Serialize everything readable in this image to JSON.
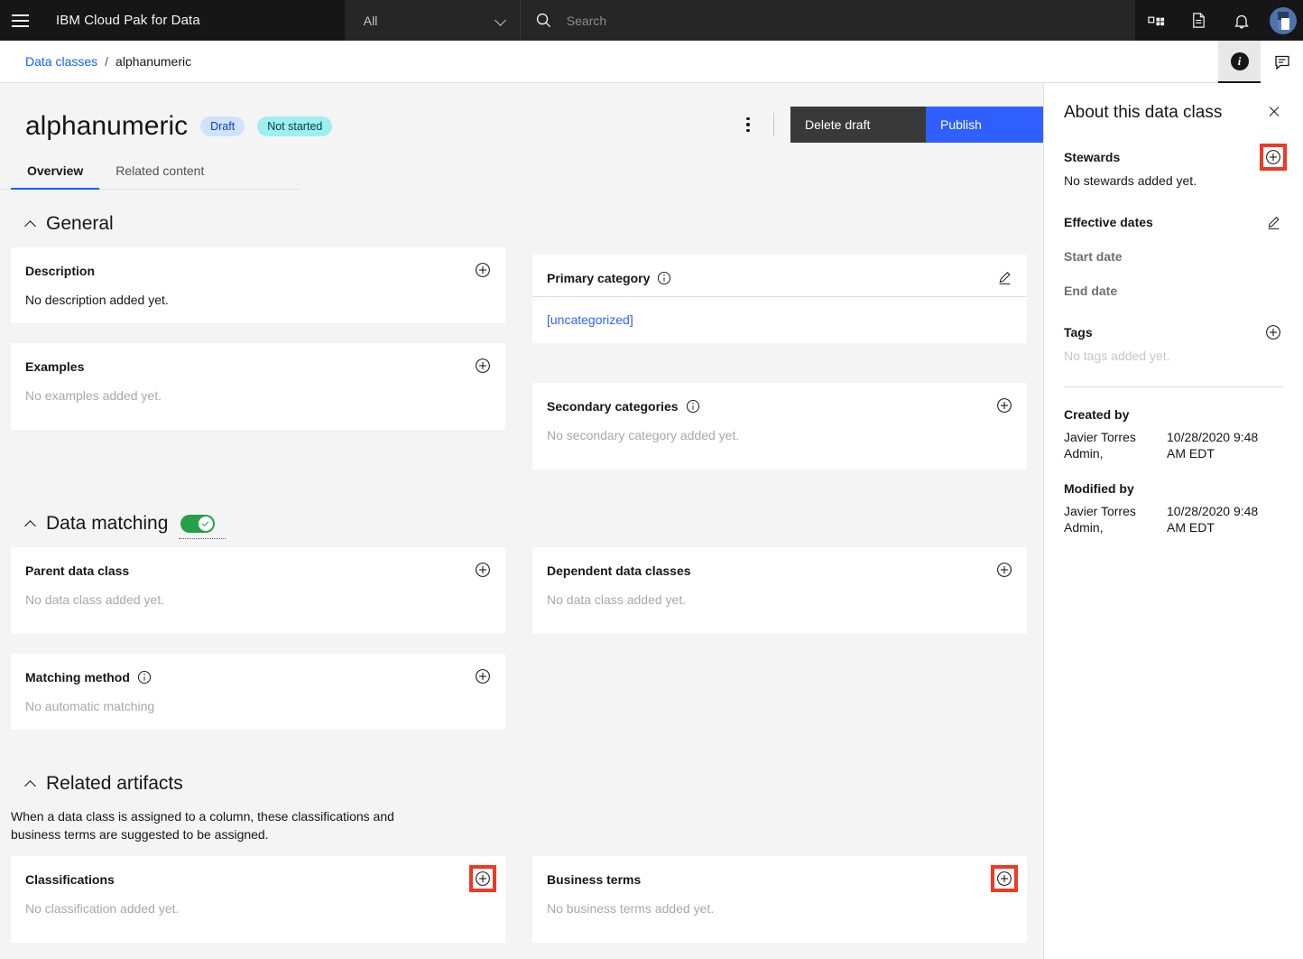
{
  "header": {
    "menu_icon": "hamburger-icon",
    "brand": "IBM Cloud Pak for Data",
    "scope_selected": "All",
    "search_placeholder": "Search",
    "icons": [
      "app-switcher-icon",
      "document-icon",
      "notification-bell-icon"
    ],
    "avatar": "user-avatar"
  },
  "breadcrumb": {
    "parent": "Data classes",
    "separator": "/",
    "current": "alphanumeric"
  },
  "rail": {
    "info_tab": "info-icon",
    "comments_tab": "comment-icon"
  },
  "page": {
    "title": "alphanumeric",
    "tag_draft": "Draft",
    "tag_status": "Not started",
    "overflow_menu": "overflow-menu",
    "delete_label": "Delete draft",
    "publish_label": "Publish"
  },
  "tabs": [
    {
      "label": "Overview",
      "active": true
    },
    {
      "label": "Related content",
      "active": false
    }
  ],
  "sections": {
    "general": {
      "title": "General",
      "description": {
        "title": "Description",
        "value": "No description added yet.",
        "action": "add-icon"
      },
      "examples": {
        "title": "Examples",
        "value": "No examples added yet.",
        "action": "add-icon"
      },
      "primary_category": {
        "title": "Primary category",
        "info": "info-icon",
        "value": "[uncategorized]",
        "action": "edit-icon"
      },
      "secondary_categories": {
        "title": "Secondary categories",
        "info": "info-icon",
        "value": "No secondary category added yet.",
        "action": "add-icon"
      }
    },
    "data_matching": {
      "title": "Data matching",
      "toggle_on": true,
      "parent_data_class": {
        "title": "Parent data class",
        "value": "No data class added yet.",
        "action": "add-icon"
      },
      "dependent_data_classes": {
        "title": "Dependent data classes",
        "value": "No data class added yet.",
        "action": "add-icon"
      },
      "matching_method": {
        "title": "Matching method",
        "info": "info-icon",
        "value": "No automatic matching",
        "action": "add-icon"
      }
    },
    "related_artifacts": {
      "title": "Related artifacts",
      "help": "When a data class is assigned to a column, these classifications and business terms are suggested to be assigned.",
      "classifications": {
        "title": "Classifications",
        "value": "No classification added yet.",
        "action": "add-icon"
      },
      "business_terms": {
        "title": "Business terms",
        "value": "No business terms added yet.",
        "action": "add-icon"
      }
    }
  },
  "panel": {
    "title": "About this data class",
    "close": "close-icon",
    "stewards": {
      "label": "Stewards",
      "value": "No stewards added yet.",
      "action": "add-icon"
    },
    "effective_dates": {
      "label": "Effective dates",
      "action": "edit-icon",
      "start_label": "Start date",
      "end_label": "End date"
    },
    "tags": {
      "label": "Tags",
      "value": "No tags added yet.",
      "action": "add-icon"
    },
    "created_by": {
      "label": "Created by",
      "user": "Javier Torres Admin,",
      "timestamp": "10/28/2020 9:48 AM EDT"
    },
    "modified_by": {
      "label": "Modified by",
      "user": "Javier Torres Admin,",
      "timestamp": "10/28/2020 9:48 AM EDT"
    }
  },
  "colors": {
    "accent_blue": "#2f5ffe",
    "link_blue": "#0f62fe",
    "highlight_red": "#ee3a22",
    "toggle_green": "#24a148",
    "header_black": "#161616"
  }
}
